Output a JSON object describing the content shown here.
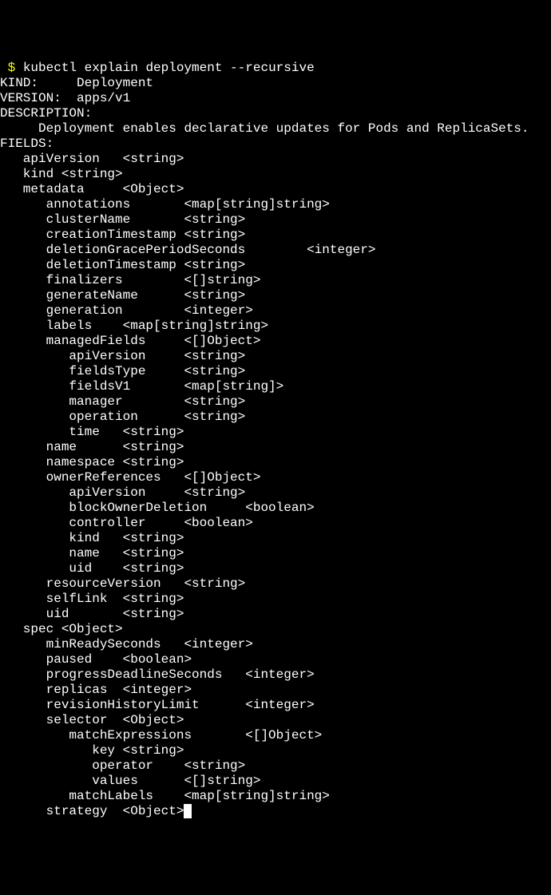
{
  "prompt": " $ ",
  "command": "kubectl explain deployment --recursive",
  "lines": [
    "KIND:     Deployment",
    "VERSION:  apps/v1",
    "",
    "DESCRIPTION:",
    "     Deployment enables declarative updates for Pods and ReplicaSets.",
    "",
    "FIELDS:",
    "   apiVersion   <string>",
    "   kind <string>",
    "   metadata     <Object>",
    "      annotations       <map[string]string>",
    "      clusterName       <string>",
    "      creationTimestamp <string>",
    "      deletionGracePeriodSeconds        <integer>",
    "      deletionTimestamp <string>",
    "      finalizers        <[]string>",
    "      generateName      <string>",
    "      generation        <integer>",
    "      labels    <map[string]string>",
    "      managedFields     <[]Object>",
    "         apiVersion     <string>",
    "         fieldsType     <string>",
    "         fieldsV1       <map[string]>",
    "         manager        <string>",
    "         operation      <string>",
    "         time   <string>",
    "      name      <string>",
    "      namespace <string>",
    "      ownerReferences   <[]Object>",
    "         apiVersion     <string>",
    "         blockOwnerDeletion     <boolean>",
    "         controller     <boolean>",
    "         kind   <string>",
    "         name   <string>",
    "         uid    <string>",
    "      resourceVersion   <string>",
    "      selfLink  <string>",
    "      uid       <string>",
    "   spec <Object>",
    "      minReadySeconds   <integer>",
    "      paused    <boolean>",
    "      progressDeadlineSeconds   <integer>",
    "      replicas  <integer>",
    "      revisionHistoryLimit      <integer>",
    "      selector  <Object>",
    "         matchExpressions       <[]Object>",
    "            key <string>",
    "            operator    <string>",
    "            values      <[]string>",
    "         matchLabels    <map[string]string>"
  ],
  "last_line": "      strategy  <Object>"
}
